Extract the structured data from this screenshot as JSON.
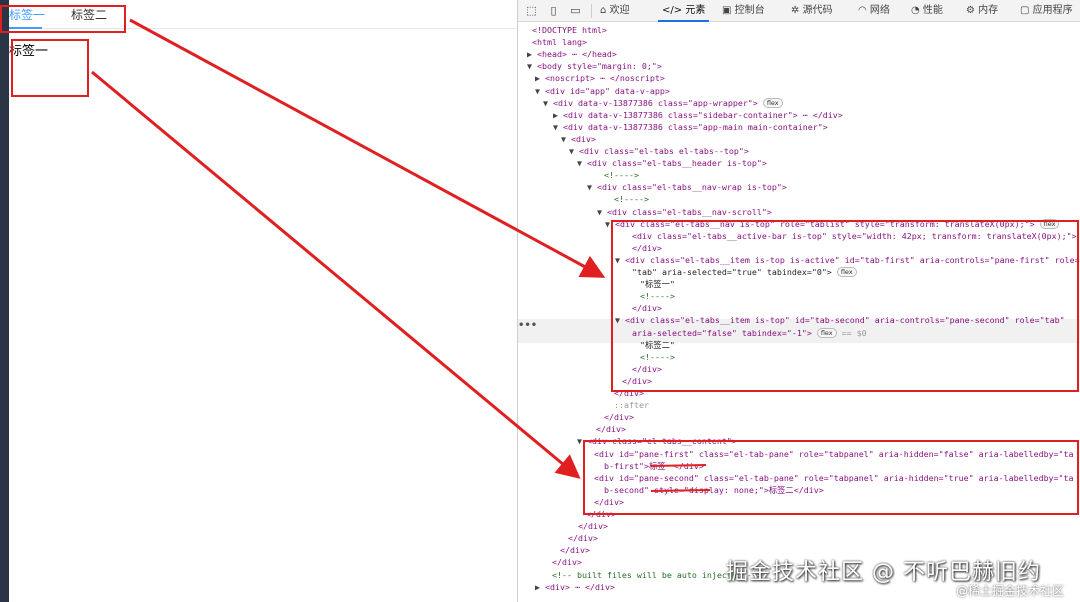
{
  "app": {
    "tabs": [
      {
        "label": "标签一"
      },
      {
        "label": "标签二"
      }
    ],
    "pane_text": "标签一"
  },
  "devtools": {
    "toolbar": {
      "welcome": "欢迎",
      "elements": "元素",
      "console": "控制台",
      "sources": "源代码",
      "network": "网络",
      "performance": "性能",
      "memory": "内存",
      "application": "应用程序",
      "elements_code_glyph": "</>"
    },
    "dom_lines": [
      "<!DOCTYPE html>",
      "<html lang>",
      "<head> ⋯ </head>",
      "<body style=\"margin: 0;\">",
      "<noscript> ⋯ </noscript>",
      "<div id=\"app\" data-v-app>",
      "<div data-v-13877386 class=\"app-wrapper\">",
      "<div data-v-13877386 class=\"sidebar-container\"> ⋯ </div>",
      "<div data-v-13877386 class=\"app-main main-container\">",
      "<div>",
      "<div class=\"el-tabs el-tabs--top\">",
      "<div class=\"el-tabs__header is-top\">",
      "<!---->",
      "<div class=\"el-tabs__nav-wrap is-top\">",
      "<!---->",
      "<div class=\"el-tabs__nav-scroll\">",
      "<div class=\"el-tabs__nav is-top\" role=\"tablist\" style=\"transform: translateX(0px);\">",
      "<div class=\"el-tabs__active-bar is-top\" style=\"width: 42px; transform: translateX(0px);\">",
      "</div>",
      "<div class=\"el-tabs__item is-top is-active\" id=\"tab-first\" aria-controls=\"pane-first\" role=",
      "\"tab\" aria-selected=\"true\" tabindex=\"0\">",
      "\"标签一\"",
      "<!---->",
      "</div>",
      "<div class=\"el-tabs__item is-top\" id=\"tab-second\" aria-controls=\"pane-second\" role=\"tab\"",
      "aria-selected=\"false\" tabindex=\"-1\">",
      "\"标签二\"",
      "<!---->",
      "</div>",
      "</div>",
      "</div>",
      "::after",
      "</div>",
      "</div>",
      "<div class=\"el-tabs__content\">",
      "<div id=\"pane-first\" class=\"el-tab-pane\" role=\"tabpanel\" aria-hidden=\"false\" aria-labelledby=\"ta",
      "b-first\">标签一</div>",
      "<div id=\"pane-second\" class=\"el-tab-pane\" role=\"tabpanel\" aria-hidden=\"true\" aria-labelledby=\"ta",
      "b-second\" style=\"display: none;\">标签二</div>",
      "</div>",
      "</div>",
      "</div>",
      "</div>",
      "</div>",
      "</div>",
      "<!-- built files will be auto injected -->",
      "<div> ⋯ </div>"
    ],
    "pills": {
      "flex": "flex",
      "eq": "== $0"
    },
    "row_dots": "•••"
  },
  "watermark": {
    "main": "掘金技术社区 @ 不听巴赫旧约",
    "sub": "@稀土掘金技术社区"
  },
  "colors": {
    "accent": "#409eff",
    "annotation": "#e02020",
    "tag": "#881280",
    "attr_name": "#994500",
    "attr_value": "#1a1aa6",
    "comment": "#236e25"
  }
}
